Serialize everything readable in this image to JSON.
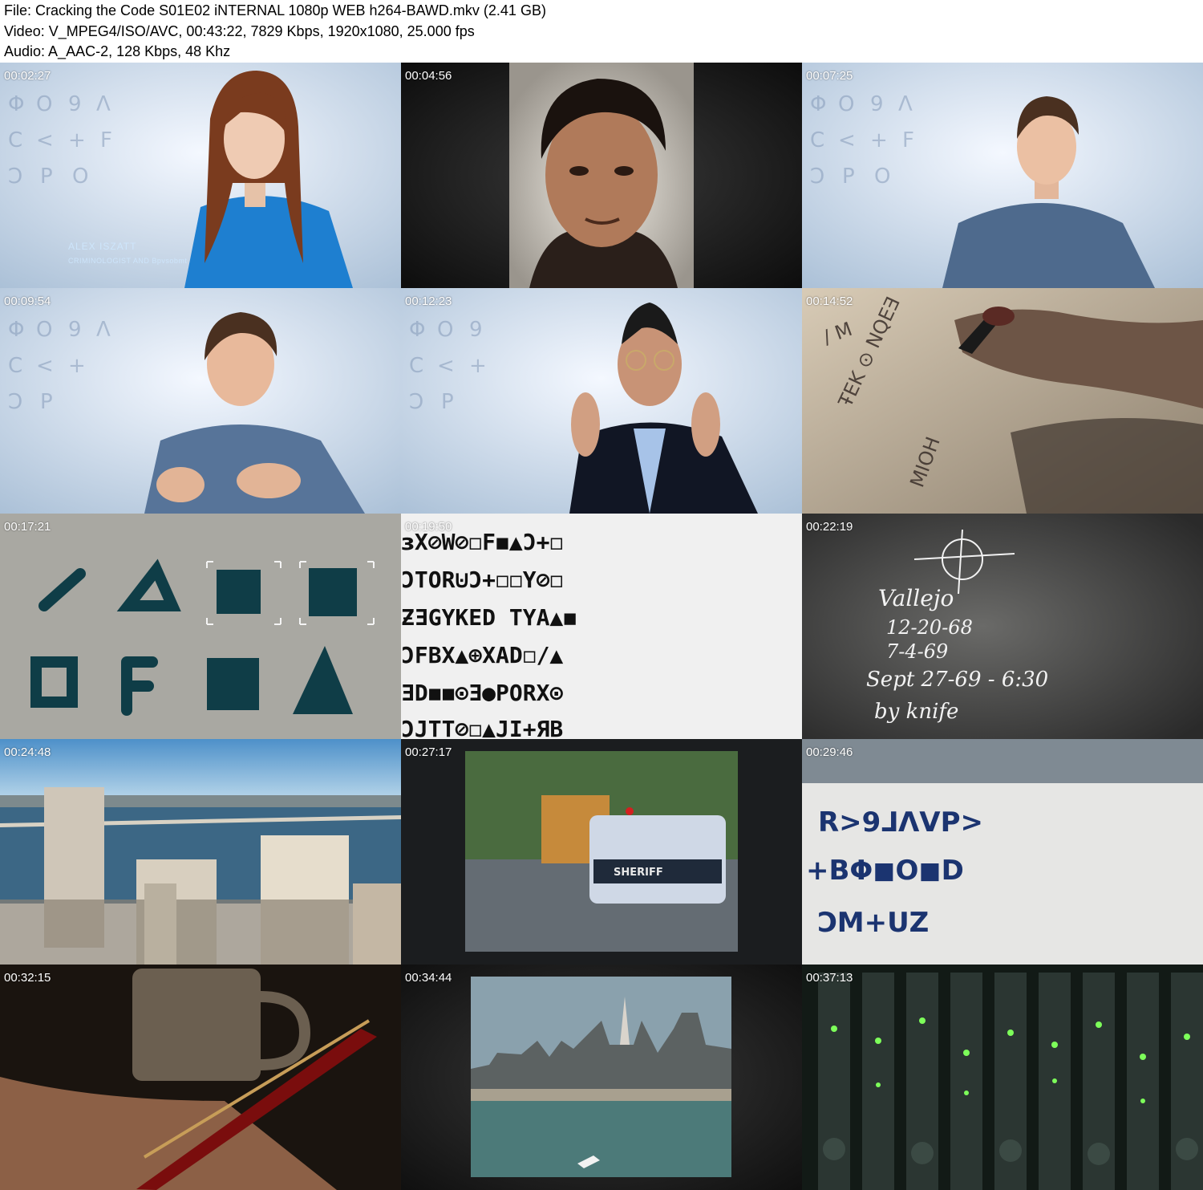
{
  "header": {
    "file_line": "File: Cracking the Code S01E02 iNTERNAL 1080p WEB h264-BAWD.mkv (2.41 GB)",
    "video_line": "Video: V_MPEG4/ISO/AVC, 00:43:22, 7829 Kbps, 1920x1080, 25.000 fps",
    "audio_line": "Audio: A_AAC-2, 128 Kbps, 48 Khz"
  },
  "thumbnails": [
    {
      "timestamp": "00:02:27",
      "scene": "interview-woman-blue",
      "caption_name": "ALEX ISZATT",
      "caption_role": "CRIMINOLOGIST AND Bpvsobmt"
    },
    {
      "timestamp": "00:04:56",
      "scene": "vintage-portrait"
    },
    {
      "timestamp": "00:07:25",
      "scene": "interview-man-shirt-right"
    },
    {
      "timestamp": "00:09:54",
      "scene": "interview-man-shirt-center"
    },
    {
      "timestamp": "00:12:23",
      "scene": "interview-man-glasses-vest"
    },
    {
      "timestamp": "00:14:52",
      "scene": "handwriting-pen"
    },
    {
      "timestamp": "00:17:21",
      "scene": "cipher-symbols-closeup"
    },
    {
      "timestamp": "00:19:50",
      "scene": "cipher-grid"
    },
    {
      "timestamp": "00:22:19",
      "scene": "crosshair-note"
    },
    {
      "timestamp": "00:24:48",
      "scene": "city-bay-bridge"
    },
    {
      "timestamp": "00:27:17",
      "scene": "sheriff-car"
    },
    {
      "timestamp": "00:29:46",
      "scene": "cipher-paper"
    },
    {
      "timestamp": "00:32:15",
      "scene": "mug-and-pen"
    },
    {
      "timestamp": "00:34:44",
      "scene": "city-skyline-water"
    },
    {
      "timestamp": "00:37:13",
      "scene": "server-rack"
    }
  ]
}
